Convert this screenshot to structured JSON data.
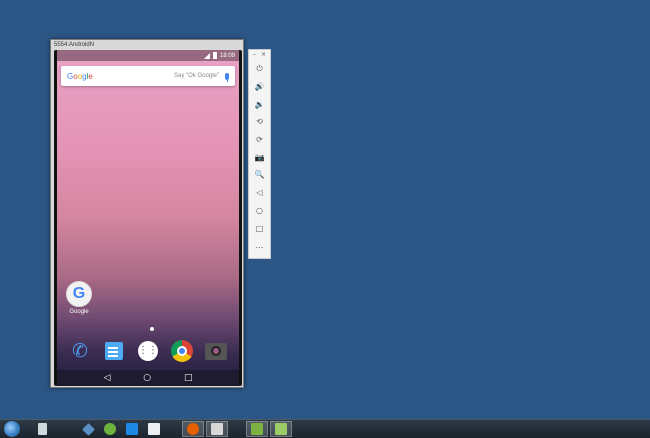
{
  "emulator": {
    "title": "5554:AndroidN",
    "status_time": "18:09",
    "search": {
      "logo": "Google",
      "placeholder": "Say \"Ok Google\""
    },
    "home_app": {
      "label": "Google",
      "icon": "google-g-icon"
    },
    "dock": [
      "phone-icon",
      "messages-icon",
      "app-drawer-icon",
      "chrome-icon",
      "camera-icon"
    ],
    "nav": {
      "back": "◁",
      "home": "○",
      "recents": "□"
    }
  },
  "side_toolbar": {
    "minimize": "–",
    "close": "×",
    "tools": [
      {
        "name": "power-icon",
        "glyph": "⏻"
      },
      {
        "name": "volume-up-icon",
        "glyph": "🔊"
      },
      {
        "name": "volume-down-icon",
        "glyph": "🔉"
      },
      {
        "name": "rotate-left-icon",
        "glyph": "⟲"
      },
      {
        "name": "rotate-right-icon",
        "glyph": "⟳"
      },
      {
        "name": "screenshot-icon",
        "glyph": "📷"
      },
      {
        "name": "zoom-icon",
        "glyph": "🔍"
      },
      {
        "name": "back-icon",
        "glyph": "◁"
      },
      {
        "name": "home-icon",
        "glyph": "○"
      },
      {
        "name": "overview-icon",
        "glyph": "□"
      },
      {
        "name": "more-icon",
        "glyph": "…"
      }
    ]
  },
  "taskbar": {
    "items": [
      "start-orb",
      "recycle-bin-icon",
      "virtualbox-icon",
      "green-app-icon",
      "windows-store-icon",
      "notepad-icon",
      "firefox-icon",
      "explorer-icon",
      "download-icon",
      "android-studio-icon"
    ]
  },
  "colors": {
    "desktop": "#2b5686",
    "accent": "#4285f4"
  }
}
